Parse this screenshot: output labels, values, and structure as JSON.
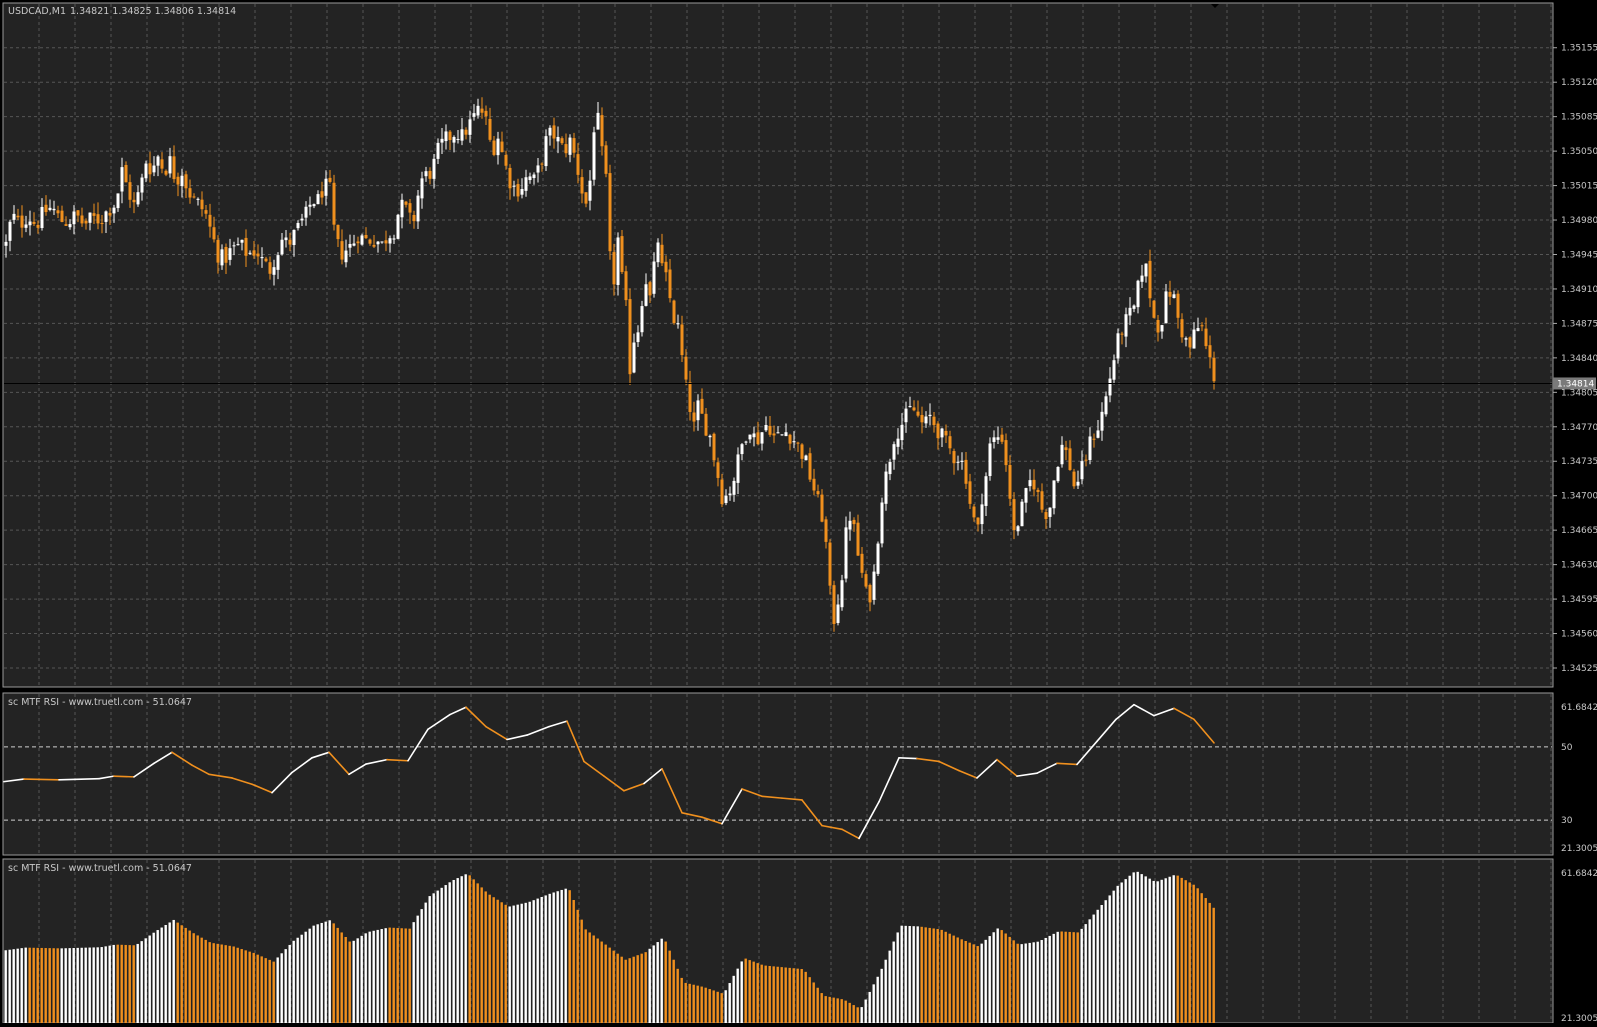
{
  "colors": {
    "background": "#232323",
    "grid": "#565656",
    "up": "#ffffff",
    "down": "#f0901e",
    "text": "#c8c8c8",
    "price_tag_bg": "#7a7a7a"
  },
  "header": {
    "symbol": "USDCAD,M1",
    "ohlc": "1.34821 1.34825 1.34806 1.34814"
  },
  "indicator1": {
    "title": "sc MTF RSI - www.truetl.com - 51.0647"
  },
  "indicator2": {
    "title": "sc MTF RSI - www.truetl.com - 51.0647"
  },
  "chart_data": [
    {
      "type": "candlestick",
      "symbol": "USDCAD",
      "timeframe": "M1",
      "ylim": [
        1.34525,
        1.35172
      ],
      "y_ticks": [
        "1.35155",
        "1.35120",
        "1.35085",
        "1.35050",
        "1.35015",
        "1.34980",
        "1.34945",
        "1.34910",
        "1.34875",
        "1.34840",
        "1.34805",
        "1.34770",
        "1.34735",
        "1.34700",
        "1.34665",
        "1.34630",
        "1.34595",
        "1.34560",
        "1.34525"
      ],
      "current_price": "1.34814",
      "close_path": [
        [
          0,
          1.34955
        ],
        [
          6,
          1.34985
        ],
        [
          14,
          1.34975
        ],
        [
          22,
          1.34985
        ],
        [
          30,
          1.34975
        ],
        [
          38,
          1.34988
        ],
        [
          46,
          1.34993
        ],
        [
          54,
          1.3498
        ],
        [
          62,
          1.34978
        ],
        [
          70,
          1.34985
        ],
        [
          78,
          1.34975
        ],
        [
          86,
          1.34982
        ],
        [
          94,
          1.3498
        ],
        [
          102,
          1.3499
        ],
        [
          110,
          1.34998
        ],
        [
          116,
          1.3503
        ],
        [
          122,
          1.3501
        ],
        [
          128,
          1.34995
        ],
        [
          134,
          1.3501
        ],
        [
          140,
          1.3504
        ],
        [
          146,
          1.3503
        ],
        [
          152,
          1.35045
        ],
        [
          158,
          1.3503
        ],
        [
          164,
          1.3504
        ],
        [
          170,
          1.3502
        ],
        [
          176,
          1.3503
        ],
        [
          182,
          1.3501
        ],
        [
          188,
          1.35
        ],
        [
          194,
          1.34995
        ],
        [
          200,
          1.34985
        ],
        [
          206,
          1.34965
        ],
        [
          212,
          1.34945
        ],
        [
          218,
          1.3494
        ],
        [
          226,
          1.3495
        ],
        [
          234,
          1.34955
        ],
        [
          242,
          1.34945
        ],
        [
          250,
          1.3495
        ],
        [
          258,
          1.34935
        ],
        [
          264,
          1.3493
        ],
        [
          270,
          1.34945
        ],
        [
          276,
          1.3496
        ],
        [
          282,
          1.34955
        ],
        [
          288,
          1.34965
        ],
        [
          294,
          1.34975
        ],
        [
          300,
          1.34985
        ],
        [
          306,
          1.35
        ],
        [
          312,
          1.35
        ],
        [
          318,
          1.35015
        ],
        [
          324,
          1.3501
        ],
        [
          328,
          1.3497
        ],
        [
          334,
          1.34945
        ],
        [
          340,
          1.3495
        ],
        [
          346,
          1.34955
        ],
        [
          352,
          1.34965
        ],
        [
          358,
          1.3496
        ],
        [
          364,
          1.3496
        ],
        [
          370,
          1.3496
        ],
        [
          376,
          1.34955
        ],
        [
          382,
          1.34965
        ],
        [
          388,
          1.3497
        ],
        [
          394,
          1.34995
        ],
        [
          400,
          1.3499
        ],
        [
          406,
          1.34975
        ],
        [
          410,
          1.3499
        ],
        [
          414,
          1.3502
        ],
        [
          420,
          1.35025
        ],
        [
          426,
          1.3503
        ],
        [
          432,
          1.3505
        ],
        [
          438,
          1.3506
        ],
        [
          444,
          1.35065
        ],
        [
          450,
          1.3507
        ],
        [
          456,
          1.35065
        ],
        [
          462,
          1.35075
        ],
        [
          468,
          1.35085
        ],
        [
          474,
          1.35095
        ],
        [
          480,
          1.3508
        ],
        [
          486,
          1.3505
        ],
        [
          492,
          1.35065
        ],
        [
          498,
          1.3504
        ],
        [
          504,
          1.3502
        ],
        [
          510,
          1.3501
        ],
        [
          516,
          1.35015
        ],
        [
          522,
          1.35025
        ],
        [
          528,
          1.3502
        ],
        [
          534,
          1.35035
        ],
        [
          540,
          1.3506
        ],
        [
          546,
          1.3507
        ],
        [
          552,
          1.3506
        ],
        [
          558,
          1.3505
        ],
        [
          564,
          1.3506
        ],
        [
          570,
          1.3504
        ],
        [
          576,
          1.3501
        ],
        [
          582,
          1.3499
        ],
        [
          586,
          1.3505
        ],
        [
          590,
          1.351
        ],
        [
          594,
          1.3506
        ],
        [
          600,
          1.3502
        ],
        [
          604,
          1.3494
        ],
        [
          608,
          1.3492
        ],
        [
          612,
          1.3496
        ],
        [
          616,
          1.3492
        ],
        [
          620,
          1.3489
        ],
        [
          624,
          1.3483
        ],
        [
          628,
          1.3486
        ],
        [
          632,
          1.3487
        ],
        [
          636,
          1.349
        ],
        [
          640,
          1.3492
        ],
        [
          644,
          1.349
        ],
        [
          648,
          1.3493
        ],
        [
          652,
          1.3496
        ],
        [
          656,
          1.3493
        ],
        [
          660,
          1.3492
        ],
        [
          664,
          1.349
        ],
        [
          668,
          1.3488
        ],
        [
          672,
          1.3487
        ],
        [
          676,
          1.3484
        ],
        [
          680,
          1.3481
        ],
        [
          684,
          1.3479
        ],
        [
          688,
          1.3477
        ],
        [
          692,
          1.3479
        ],
        [
          696,
          1.3478
        ],
        [
          700,
          1.3477
        ],
        [
          704,
          1.3476
        ],
        [
          708,
          1.3474
        ],
        [
          712,
          1.3472
        ],
        [
          716,
          1.347
        ],
        [
          720,
          1.347
        ],
        [
          726,
          1.3471
        ],
        [
          732,
          1.34735
        ],
        [
          738,
          1.3476
        ],
        [
          744,
          1.3477
        ],
        [
          750,
          1.34755
        ],
        [
          756,
          1.34765
        ],
        [
          762,
          1.34775
        ],
        [
          768,
          1.3476
        ],
        [
          774,
          1.3476
        ],
        [
          780,
          1.34765
        ],
        [
          786,
          1.3476
        ],
        [
          792,
          1.3475
        ],
        [
          798,
          1.3474
        ],
        [
          804,
          1.3472
        ],
        [
          810,
          1.347
        ],
        [
          816,
          1.3468
        ],
        [
          820,
          1.3465
        ],
        [
          824,
          1.346
        ],
        [
          828,
          1.34575
        ],
        [
          832,
          1.34595
        ],
        [
          836,
          1.3462
        ],
        [
          840,
          1.3466
        ],
        [
          844,
          1.3468
        ],
        [
          848,
          1.34665
        ],
        [
          852,
          1.3464
        ],
        [
          856,
          1.3462
        ],
        [
          860,
          1.346
        ],
        [
          864,
          1.346
        ],
        [
          868,
          1.3462
        ],
        [
          872,
          1.3466
        ],
        [
          876,
          1.347
        ],
        [
          880,
          1.3472
        ],
        [
          884,
          1.3474
        ],
        [
          888,
          1.3476
        ],
        [
          894,
          1.3477
        ],
        [
          900,
          1.3478
        ],
        [
          906,
          1.3479
        ],
        [
          912,
          1.3478
        ],
        [
          918,
          1.3477
        ],
        [
          924,
          1.3478
        ],
        [
          930,
          1.3477
        ],
        [
          936,
          1.3476
        ],
        [
          942,
          1.3475
        ],
        [
          948,
          1.3474
        ],
        [
          954,
          1.3474
        ],
        [
          960,
          1.3472
        ],
        [
          966,
          1.3468
        ],
        [
          972,
          1.34665
        ],
        [
          976,
          1.347
        ],
        [
          980,
          1.3472
        ],
        [
          984,
          1.3475
        ],
        [
          990,
          1.3476
        ],
        [
          996,
          1.3476
        ],
        [
          1002,
          1.3472
        ],
        [
          1008,
          1.3466
        ],
        [
          1014,
          1.3468
        ],
        [
          1020,
          1.347
        ],
        [
          1026,
          1.3472
        ],
        [
          1032,
          1.347
        ],
        [
          1038,
          1.3468
        ],
        [
          1044,
          1.3469
        ],
        [
          1050,
          1.3473
        ],
        [
          1056,
          1.3475
        ],
        [
          1062,
          1.3474
        ],
        [
          1068,
          1.3471
        ],
        [
          1074,
          1.3472
        ],
        [
          1080,
          1.3474
        ],
        [
          1086,
          1.3476
        ],
        [
          1092,
          1.3477
        ],
        [
          1098,
          1.3479
        ],
        [
          1104,
          1.3482
        ],
        [
          1110,
          1.3485
        ],
        [
          1116,
          1.3487
        ],
        [
          1122,
          1.3488
        ],
        [
          1128,
          1.3489
        ],
        [
          1134,
          1.3492
        ],
        [
          1138,
          1.3494
        ],
        [
          1142,
          1.3492
        ],
        [
          1146,
          1.3489
        ],
        [
          1150,
          1.3487
        ],
        [
          1156,
          1.3488
        ],
        [
          1160,
          1.349
        ],
        [
          1166,
          1.3491
        ],
        [
          1172,
          1.3488
        ],
        [
          1178,
          1.3486
        ],
        [
          1184,
          1.3485
        ],
        [
          1190,
          1.3487
        ],
        [
          1196,
          1.3487
        ],
        [
          1200,
          1.3485
        ],
        [
          1206,
          1.3483
        ],
        [
          1210,
          1.34814
        ]
      ]
    },
    {
      "type": "line",
      "title": "sc MTF RSI - www.truetl.com - 51.0647",
      "ylim": [
        21.3005,
        61.6842
      ],
      "y_ticks": [
        "61.6842",
        "50",
        "30",
        "21.3005"
      ],
      "levels": [
        50,
        30
      ],
      "last_value": 51.0647,
      "series": [
        {
          "x": 0,
          "v": 40.5,
          "c": "up"
        },
        {
          "x": 20,
          "v": 41.2,
          "c": "up"
        },
        {
          "x": 55,
          "v": 41.0,
          "c": "down"
        },
        {
          "x": 95,
          "v": 41.3,
          "c": "up"
        },
        {
          "x": 110,
          "v": 42.0,
          "c": "up"
        },
        {
          "x": 130,
          "v": 41.8,
          "c": "down"
        },
        {
          "x": 150,
          "v": 45.5,
          "c": "up"
        },
        {
          "x": 168,
          "v": 48.5,
          "c": "up"
        },
        {
          "x": 188,
          "v": 45.0,
          "c": "down"
        },
        {
          "x": 205,
          "v": 42.5,
          "c": "down"
        },
        {
          "x": 228,
          "v": 41.5,
          "c": "down"
        },
        {
          "x": 248,
          "v": 39.8,
          "c": "down"
        },
        {
          "x": 268,
          "v": 37.5,
          "c": "down"
        },
        {
          "x": 288,
          "v": 43.0,
          "c": "up"
        },
        {
          "x": 308,
          "v": 47.0,
          "c": "up"
        },
        {
          "x": 325,
          "v": 48.5,
          "c": "up"
        },
        {
          "x": 345,
          "v": 42.5,
          "c": "down"
        },
        {
          "x": 362,
          "v": 45.3,
          "c": "up"
        },
        {
          "x": 383,
          "v": 46.5,
          "c": "up"
        },
        {
          "x": 404,
          "v": 46.2,
          "c": "down"
        },
        {
          "x": 424,
          "v": 54.8,
          "c": "up"
        },
        {
          "x": 446,
          "v": 58.8,
          "c": "up"
        },
        {
          "x": 462,
          "v": 60.8,
          "c": "up"
        },
        {
          "x": 482,
          "v": 55.5,
          "c": "down"
        },
        {
          "x": 503,
          "v": 52.0,
          "c": "down"
        },
        {
          "x": 523,
          "v": 53.2,
          "c": "up"
        },
        {
          "x": 545,
          "v": 55.5,
          "c": "up"
        },
        {
          "x": 563,
          "v": 57.0,
          "c": "up"
        },
        {
          "x": 580,
          "v": 46.0,
          "c": "down"
        },
        {
          "x": 600,
          "v": 42.0,
          "c": "down"
        },
        {
          "x": 620,
          "v": 38.0,
          "c": "down"
        },
        {
          "x": 640,
          "v": 40.0,
          "c": "down"
        },
        {
          "x": 658,
          "v": 44.0,
          "c": "up"
        },
        {
          "x": 678,
          "v": 32.0,
          "c": "down"
        },
        {
          "x": 698,
          "v": 30.8,
          "c": "down"
        },
        {
          "x": 718,
          "v": 29.0,
          "c": "down"
        },
        {
          "x": 738,
          "v": 38.5,
          "c": "up"
        },
        {
          "x": 758,
          "v": 36.5,
          "c": "down"
        },
        {
          "x": 778,
          "v": 36.0,
          "c": "down"
        },
        {
          "x": 798,
          "v": 35.5,
          "c": "down"
        },
        {
          "x": 818,
          "v": 28.5,
          "c": "down"
        },
        {
          "x": 838,
          "v": 27.5,
          "c": "down"
        },
        {
          "x": 855,
          "v": 25.0,
          "c": "down"
        },
        {
          "x": 875,
          "v": 35.0,
          "c": "up"
        },
        {
          "x": 895,
          "v": 47.0,
          "c": "up"
        },
        {
          "x": 913,
          "v": 46.8,
          "c": "up"
        },
        {
          "x": 935,
          "v": 46.0,
          "c": "down"
        },
        {
          "x": 955,
          "v": 43.5,
          "c": "down"
        },
        {
          "x": 973,
          "v": 41.5,
          "c": "down"
        },
        {
          "x": 993,
          "v": 46.5,
          "c": "up"
        },
        {
          "x": 1013,
          "v": 42.0,
          "c": "down"
        },
        {
          "x": 1033,
          "v": 42.8,
          "c": "up"
        },
        {
          "x": 1053,
          "v": 45.5,
          "c": "up"
        },
        {
          "x": 1073,
          "v": 45.2,
          "c": "down"
        },
        {
          "x": 1093,
          "v": 51.5,
          "c": "up"
        },
        {
          "x": 1112,
          "v": 57.5,
          "c": "up"
        },
        {
          "x": 1130,
          "v": 61.5,
          "c": "up"
        },
        {
          "x": 1150,
          "v": 58.5,
          "c": "up"
        },
        {
          "x": 1170,
          "v": 60.5,
          "c": "up"
        },
        {
          "x": 1190,
          "v": 57.5,
          "c": "down"
        },
        {
          "x": 1210,
          "v": 51.0647,
          "c": "down"
        }
      ]
    },
    {
      "type": "bar",
      "title": "sc MTF RSI - www.truetl.com - 51.0647",
      "ylim": [
        21.3005,
        61.6842
      ],
      "y_ticks": [
        "61.6842",
        "21.3005"
      ],
      "note": "Histogram of the same RSI values; bar colour matches segment colour."
    }
  ]
}
